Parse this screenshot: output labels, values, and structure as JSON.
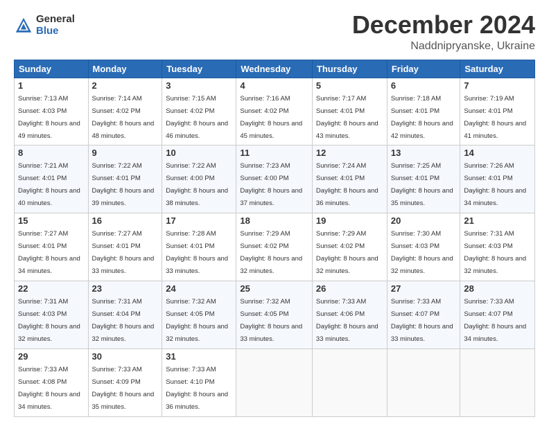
{
  "header": {
    "logo_general": "General",
    "logo_blue": "Blue",
    "month_title": "December 2024",
    "location": "Naddnipryanske, Ukraine"
  },
  "weekdays": [
    "Sunday",
    "Monday",
    "Tuesday",
    "Wednesday",
    "Thursday",
    "Friday",
    "Saturday"
  ],
  "weeks": [
    [
      {
        "day": "1",
        "sunrise": "Sunrise: 7:13 AM",
        "sunset": "Sunset: 4:03 PM",
        "daylight": "Daylight: 8 hours and 49 minutes."
      },
      {
        "day": "2",
        "sunrise": "Sunrise: 7:14 AM",
        "sunset": "Sunset: 4:02 PM",
        "daylight": "Daylight: 8 hours and 48 minutes."
      },
      {
        "day": "3",
        "sunrise": "Sunrise: 7:15 AM",
        "sunset": "Sunset: 4:02 PM",
        "daylight": "Daylight: 8 hours and 46 minutes."
      },
      {
        "day": "4",
        "sunrise": "Sunrise: 7:16 AM",
        "sunset": "Sunset: 4:02 PM",
        "daylight": "Daylight: 8 hours and 45 minutes."
      },
      {
        "day": "5",
        "sunrise": "Sunrise: 7:17 AM",
        "sunset": "Sunset: 4:01 PM",
        "daylight": "Daylight: 8 hours and 43 minutes."
      },
      {
        "day": "6",
        "sunrise": "Sunrise: 7:18 AM",
        "sunset": "Sunset: 4:01 PM",
        "daylight": "Daylight: 8 hours and 42 minutes."
      },
      {
        "day": "7",
        "sunrise": "Sunrise: 7:19 AM",
        "sunset": "Sunset: 4:01 PM",
        "daylight": "Daylight: 8 hours and 41 minutes."
      }
    ],
    [
      {
        "day": "8",
        "sunrise": "Sunrise: 7:21 AM",
        "sunset": "Sunset: 4:01 PM",
        "daylight": "Daylight: 8 hours and 40 minutes."
      },
      {
        "day": "9",
        "sunrise": "Sunrise: 7:22 AM",
        "sunset": "Sunset: 4:01 PM",
        "daylight": "Daylight: 8 hours and 39 minutes."
      },
      {
        "day": "10",
        "sunrise": "Sunrise: 7:22 AM",
        "sunset": "Sunset: 4:00 PM",
        "daylight": "Daylight: 8 hours and 38 minutes."
      },
      {
        "day": "11",
        "sunrise": "Sunrise: 7:23 AM",
        "sunset": "Sunset: 4:00 PM",
        "daylight": "Daylight: 8 hours and 37 minutes."
      },
      {
        "day": "12",
        "sunrise": "Sunrise: 7:24 AM",
        "sunset": "Sunset: 4:01 PM",
        "daylight": "Daylight: 8 hours and 36 minutes."
      },
      {
        "day": "13",
        "sunrise": "Sunrise: 7:25 AM",
        "sunset": "Sunset: 4:01 PM",
        "daylight": "Daylight: 8 hours and 35 minutes."
      },
      {
        "day": "14",
        "sunrise": "Sunrise: 7:26 AM",
        "sunset": "Sunset: 4:01 PM",
        "daylight": "Daylight: 8 hours and 34 minutes."
      }
    ],
    [
      {
        "day": "15",
        "sunrise": "Sunrise: 7:27 AM",
        "sunset": "Sunset: 4:01 PM",
        "daylight": "Daylight: 8 hours and 34 minutes."
      },
      {
        "day": "16",
        "sunrise": "Sunrise: 7:27 AM",
        "sunset": "Sunset: 4:01 PM",
        "daylight": "Daylight: 8 hours and 33 minutes."
      },
      {
        "day": "17",
        "sunrise": "Sunrise: 7:28 AM",
        "sunset": "Sunset: 4:01 PM",
        "daylight": "Daylight: 8 hours and 33 minutes."
      },
      {
        "day": "18",
        "sunrise": "Sunrise: 7:29 AM",
        "sunset": "Sunset: 4:02 PM",
        "daylight": "Daylight: 8 hours and 32 minutes."
      },
      {
        "day": "19",
        "sunrise": "Sunrise: 7:29 AM",
        "sunset": "Sunset: 4:02 PM",
        "daylight": "Daylight: 8 hours and 32 minutes."
      },
      {
        "day": "20",
        "sunrise": "Sunrise: 7:30 AM",
        "sunset": "Sunset: 4:03 PM",
        "daylight": "Daylight: 8 hours and 32 minutes."
      },
      {
        "day": "21",
        "sunrise": "Sunrise: 7:31 AM",
        "sunset": "Sunset: 4:03 PM",
        "daylight": "Daylight: 8 hours and 32 minutes."
      }
    ],
    [
      {
        "day": "22",
        "sunrise": "Sunrise: 7:31 AM",
        "sunset": "Sunset: 4:03 PM",
        "daylight": "Daylight: 8 hours and 32 minutes."
      },
      {
        "day": "23",
        "sunrise": "Sunrise: 7:31 AM",
        "sunset": "Sunset: 4:04 PM",
        "daylight": "Daylight: 8 hours and 32 minutes."
      },
      {
        "day": "24",
        "sunrise": "Sunrise: 7:32 AM",
        "sunset": "Sunset: 4:05 PM",
        "daylight": "Daylight: 8 hours and 32 minutes."
      },
      {
        "day": "25",
        "sunrise": "Sunrise: 7:32 AM",
        "sunset": "Sunset: 4:05 PM",
        "daylight": "Daylight: 8 hours and 33 minutes."
      },
      {
        "day": "26",
        "sunrise": "Sunrise: 7:33 AM",
        "sunset": "Sunset: 4:06 PM",
        "daylight": "Daylight: 8 hours and 33 minutes."
      },
      {
        "day": "27",
        "sunrise": "Sunrise: 7:33 AM",
        "sunset": "Sunset: 4:07 PM",
        "daylight": "Daylight: 8 hours and 33 minutes."
      },
      {
        "day": "28",
        "sunrise": "Sunrise: 7:33 AM",
        "sunset": "Sunset: 4:07 PM",
        "daylight": "Daylight: 8 hours and 34 minutes."
      }
    ],
    [
      {
        "day": "29",
        "sunrise": "Sunrise: 7:33 AM",
        "sunset": "Sunset: 4:08 PM",
        "daylight": "Daylight: 8 hours and 34 minutes."
      },
      {
        "day": "30",
        "sunrise": "Sunrise: 7:33 AM",
        "sunset": "Sunset: 4:09 PM",
        "daylight": "Daylight: 8 hours and 35 minutes."
      },
      {
        "day": "31",
        "sunrise": "Sunrise: 7:33 AM",
        "sunset": "Sunset: 4:10 PM",
        "daylight": "Daylight: 8 hours and 36 minutes."
      },
      null,
      null,
      null,
      null
    ]
  ]
}
